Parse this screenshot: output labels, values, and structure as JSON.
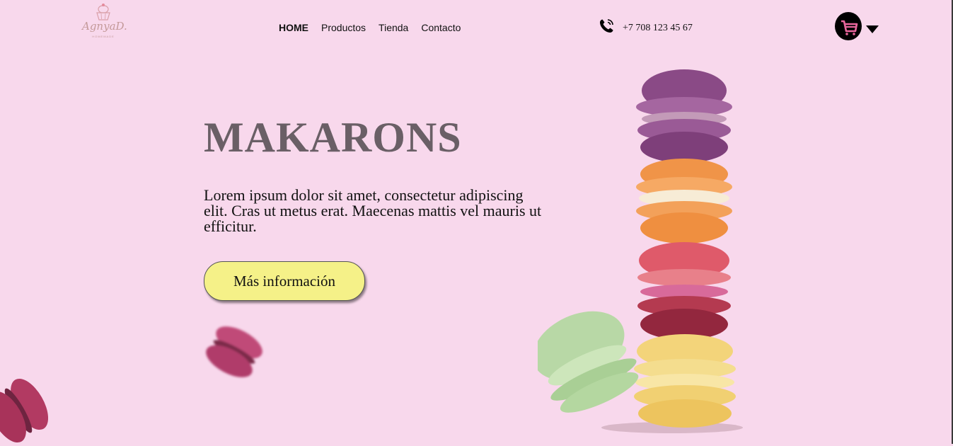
{
  "logo": {
    "text": "AgnyaD.",
    "sub": "HOMEMADE"
  },
  "nav": {
    "items": [
      {
        "label": "HOME",
        "active": true
      },
      {
        "label": "Productos",
        "active": false
      },
      {
        "label": "Tienda",
        "active": false
      },
      {
        "label": "Contacto",
        "active": false
      }
    ]
  },
  "contact": {
    "phone": "+7 708 123 45 67",
    "icon": "phone-icon"
  },
  "cart": {
    "icon": "cart-icon",
    "dropdown_icon": "caret-down-icon"
  },
  "hero": {
    "title": "MAKARONS",
    "description": "Lorem ipsum dolor sit amet, consectetur adipiscing elit. Cras ut metus erat. Maecenas mattis vel mauris ut efficitur.",
    "cta_label": "Más información"
  },
  "colors": {
    "background": "#f8d8ec",
    "title": "#6a5f66",
    "button": "#f5f188",
    "cart_accent": "#e8669c"
  }
}
